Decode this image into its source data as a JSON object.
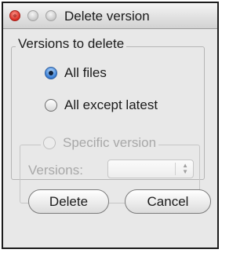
{
  "window": {
    "title": "Delete version",
    "traffic_lights": [
      "close-button",
      "minimize-button",
      "zoom-button"
    ]
  },
  "group": {
    "legend": "Versions to delete",
    "options": [
      {
        "label": "All files",
        "selected": true,
        "enabled": true
      },
      {
        "label": "All except latest",
        "selected": false,
        "enabled": true
      },
      {
        "label": "Specific version",
        "selected": false,
        "enabled": false
      }
    ]
  },
  "specific": {
    "versions_label": "Versions:",
    "versions_value": "",
    "enabled": false
  },
  "buttons": {
    "delete_label": "Delete",
    "cancel_label": "Cancel"
  },
  "colors": {
    "accent": "#3d82d8",
    "close": "#d8281f",
    "disabled_text": "#a8a8a8"
  }
}
